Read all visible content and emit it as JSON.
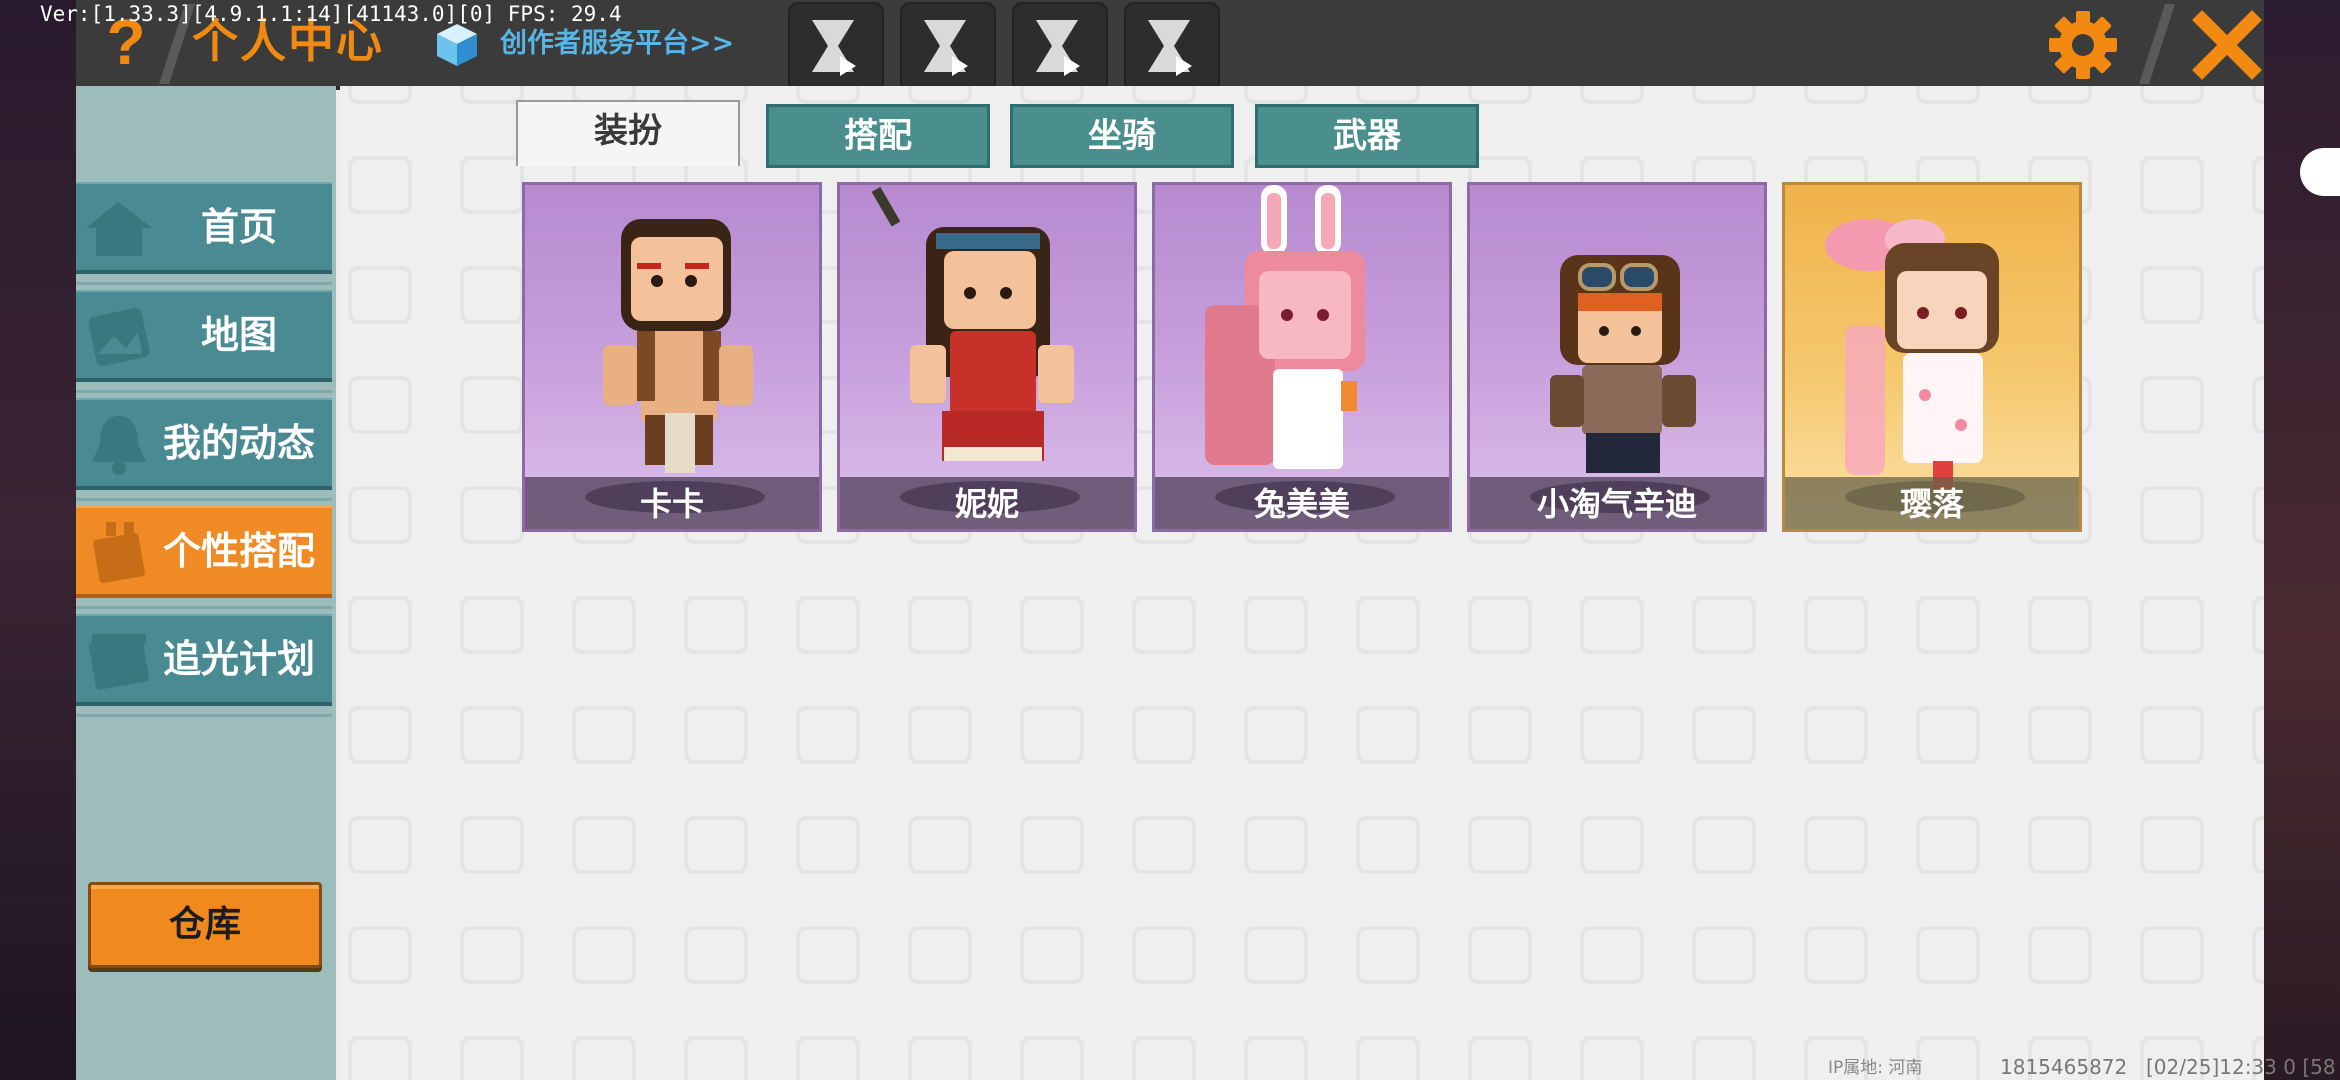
{
  "debug": {
    "version_text": "Ver:[1.33.3][4.9.1.1:14][41143.0][0] FPS: 29.4"
  },
  "header": {
    "help_glyph": "?",
    "title": "个人中心",
    "creator_link": "创作者服务平台>>",
    "icons": [
      "help-icon",
      "cube-icon",
      "hourglass-play-icon",
      "gear-icon",
      "close-icon"
    ],
    "colors": {
      "accent": "#f28a12",
      "link": "#56b6e6"
    }
  },
  "sidebar": {
    "items": [
      {
        "label": "首页",
        "icon": "home-icon",
        "active": false
      },
      {
        "label": "地图",
        "icon": "map-icon",
        "active": false
      },
      {
        "label": "我的动态",
        "icon": "bell-icon",
        "active": false
      },
      {
        "label": "个性搭配",
        "icon": "outfit-icon",
        "active": true
      },
      {
        "label": "追光计划",
        "icon": "plan-icon",
        "active": false
      }
    ],
    "warehouse_label": "仓库"
  },
  "tabs": [
    {
      "label": "装扮",
      "active": true
    },
    {
      "label": "搭配",
      "active": false
    },
    {
      "label": "坐骑",
      "active": false
    },
    {
      "label": "武器",
      "active": false
    }
  ],
  "characters": [
    {
      "name": "卡卡",
      "rarity": "purple"
    },
    {
      "name": "妮妮",
      "rarity": "purple"
    },
    {
      "name": "兔美美",
      "rarity": "purple"
    },
    {
      "name": "小淘气辛迪",
      "rarity": "purple"
    },
    {
      "name": "璎落",
      "rarity": "gold"
    }
  ],
  "footer": {
    "ip_location": "IP属地: 河南",
    "uid": "1815465872",
    "timestamp": "[02/25]12:33 0  [58"
  }
}
